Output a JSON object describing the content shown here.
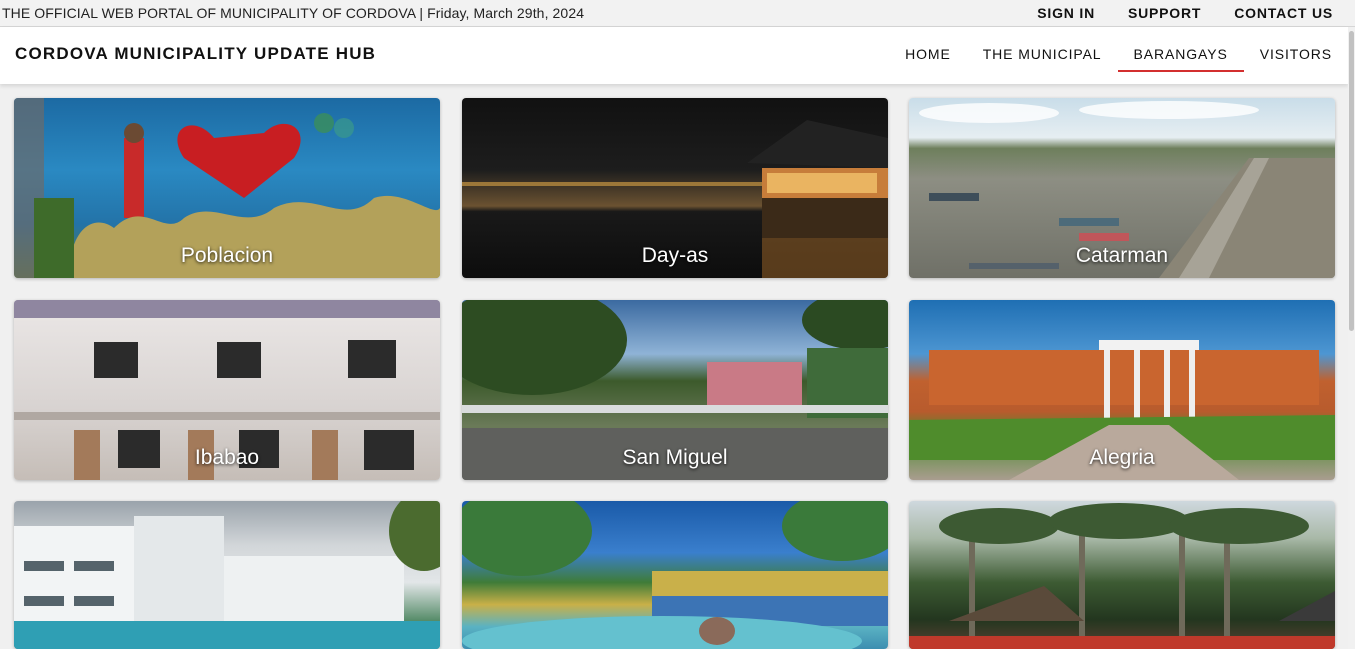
{
  "topbar": {
    "official_text": "THE OFFICIAL WEB PORTAL OF MUNICIPALITY OF CORDOVA | Friday, March 29th, 2024",
    "links": [
      "SIGN IN",
      "SUPPORT",
      "CONTACT US"
    ]
  },
  "header": {
    "brand": "CORDOVA MUNICIPALITY UPDATE HUB",
    "nav": [
      "HOME",
      "THE MUNICIPAL",
      "BARANGAYS",
      "VISITORS"
    ],
    "active_nav": "BARANGAYS"
  },
  "barangays": [
    {
      "label": "Poblacion"
    },
    {
      "label": "Day-as"
    },
    {
      "label": "Catarman"
    },
    {
      "label": "Ibabao"
    },
    {
      "label": "San Miguel"
    },
    {
      "label": "Alegria"
    },
    {
      "label": ""
    },
    {
      "label": ""
    },
    {
      "label": ""
    }
  ],
  "colors": {
    "accent": "#d32f2f",
    "page_background": "#f0f0f0"
  }
}
